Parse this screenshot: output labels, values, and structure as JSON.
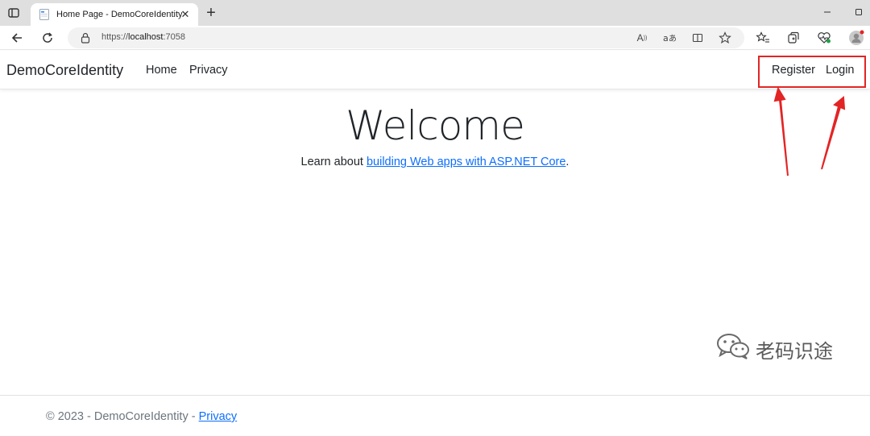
{
  "browser": {
    "tab": {
      "title": "Home Page - DemoCoreIdentity",
      "close": "✕"
    },
    "new_tab": "+",
    "address": {
      "scheme": "https://",
      "host": "localhost",
      "port": ":7058"
    }
  },
  "page": {
    "navbar": {
      "brand": "DemoCoreIdentity",
      "links": [
        {
          "label": "Home"
        },
        {
          "label": "Privacy"
        }
      ],
      "auth": [
        {
          "label": "Register"
        },
        {
          "label": "Login"
        }
      ]
    },
    "main": {
      "heading": "Welcome",
      "learn_prefix": "Learn about ",
      "learn_link": "building Web apps with ASP.NET Core",
      "learn_suffix": "."
    },
    "footer": {
      "copyright": "© 2023 - DemoCoreIdentity - ",
      "privacy_link": "Privacy"
    }
  },
  "watermark": {
    "text": "老码识途"
  },
  "annotation": {
    "highlight_color": "#e32424"
  }
}
